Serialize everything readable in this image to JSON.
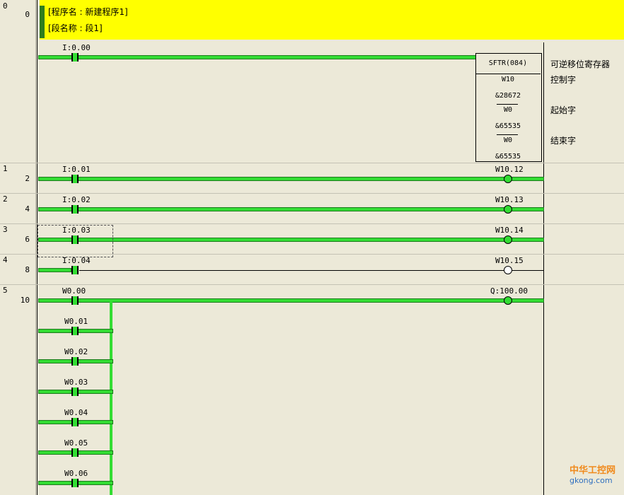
{
  "header": {
    "program_name": "[程序名 : 新建程序1]",
    "section_name": "[段名称 : 段1]"
  },
  "rungs": [
    {
      "rung": "0",
      "step": "0",
      "contact": "I:0.00",
      "energized": true
    },
    {
      "rung": "1",
      "step": "2",
      "contact": "I:0.01",
      "output": "W10.12",
      "energized": true
    },
    {
      "rung": "2",
      "step": "4",
      "contact": "I:0.02",
      "output": "W10.13",
      "energized": true
    },
    {
      "rung": "3",
      "step": "6",
      "contact": "I:0.03",
      "output": "W10.14",
      "energized": true,
      "selected": true
    },
    {
      "rung": "4",
      "step": "8",
      "contact": "I:0.04",
      "output": "W10.15",
      "energized": false
    },
    {
      "rung": "5",
      "step": "10",
      "contact": "W0.00",
      "output": "Q:100.00",
      "energized": true
    }
  ],
  "branch_contacts": [
    "W0.01",
    "W0.02",
    "W0.03",
    "W0.04",
    "W0.05",
    "W0.06"
  ],
  "sftr_block": {
    "title": "SFTR(084)",
    "operands": [
      "W10",
      "&28672",
      "W0",
      "&65535",
      "W0",
      "&65535"
    ],
    "comments": {
      "name": "可逆移位寄存器",
      "control": "控制字",
      "start": "起始字",
      "end": "结束字"
    }
  },
  "watermark": {
    "line1": "中华工控网",
    "line2": "gkong.com"
  },
  "colors": {
    "energized": "#33dd33",
    "de_energized": "#000000",
    "header_bg": "#ffff00",
    "background": "#ece9d8"
  }
}
